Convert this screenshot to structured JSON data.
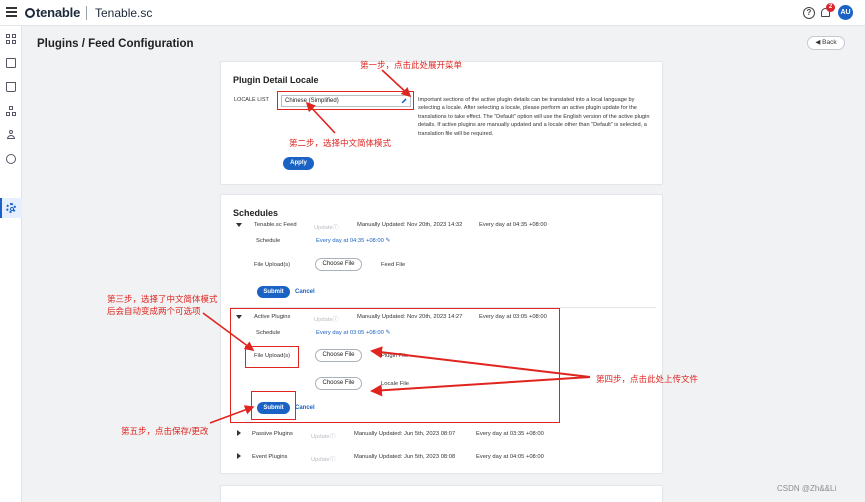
{
  "header": {
    "brand": "tenable",
    "product": "Tenable.sc",
    "notification_count": "2",
    "avatar_initials": "AU"
  },
  "page": {
    "title": "Plugins / Feed Configuration",
    "back_label": "Back"
  },
  "locale_card": {
    "title": "Plugin Detail Locale",
    "locale_list_label": "LOCALE LIST",
    "selected_locale": "Chinese (Simplified)",
    "description": "Important sections of the active plugin details can be translated into a local language by selecting a locale. After selecting a locale, please perform an active plugin update for the translations to take effect. The “Default” option will use the English version of the active plugin details. If active plugins are manually updated and a locale other than “Default” is selected, a translation file will be required.",
    "apply_label": "Apply"
  },
  "schedules": {
    "title": "Schedules",
    "update_label": "Update",
    "tenable_feed": {
      "name": "Tenable.sc Feed",
      "manual_update": "Manually Updated: Nov 20th, 2023 14:32",
      "frequency": "Every day at 04:35 +08:00",
      "schedule_label": "Schedule",
      "schedule_link": "Every day at 04:35 +08:00",
      "file_upload_label": "File Upload(s)",
      "choose_file_label": "Choose File",
      "feed_file_label": "Feed File",
      "submit_label": "Submit",
      "cancel_label": "Cancel"
    },
    "active_plugins": {
      "name": "Active Plugins",
      "manual_update": "Manually Updated: Nov 20th, 2023 14:27",
      "frequency": "Every day at 03:05 +08:00",
      "schedule_label": "Schedule",
      "schedule_link": "Every day at 03:05 +08:00",
      "file_upload_label": "File Upload(s)",
      "choose_file_label": "Choose File",
      "plugin_file_label": "Plugin File",
      "locale_file_label": "Locale File",
      "submit_label": "Submit",
      "cancel_label": "Cancel"
    },
    "passive_plugins": {
      "name": "Passive Plugins",
      "manual_update": "Manually Updated: Jun 5th, 2023 08:07",
      "frequency": "Every day at 03:35 +08:00"
    },
    "event_plugins": {
      "name": "Event Plugins",
      "manual_update": "Manually Updated: Jun 5th, 2023 08:08",
      "frequency": "Every day at 04:05 +08:00"
    }
  },
  "annotations": {
    "step1": "第一步，点击此处展开菜单",
    "step2": "第二步，选择中文简体模式",
    "step3_line1": "第三步，选择了中文简体模式",
    "step3_line2": "后会自动变成两个可选项",
    "step4": "第四步，点击此处上传文件",
    "step5": "第五步，点击保存/更改"
  },
  "watermark": "CSDN @Zh&&Li",
  "colors": {
    "accent": "#1a63c4",
    "annotation_red": "#e0241f",
    "badge_red": "#d6262f"
  }
}
